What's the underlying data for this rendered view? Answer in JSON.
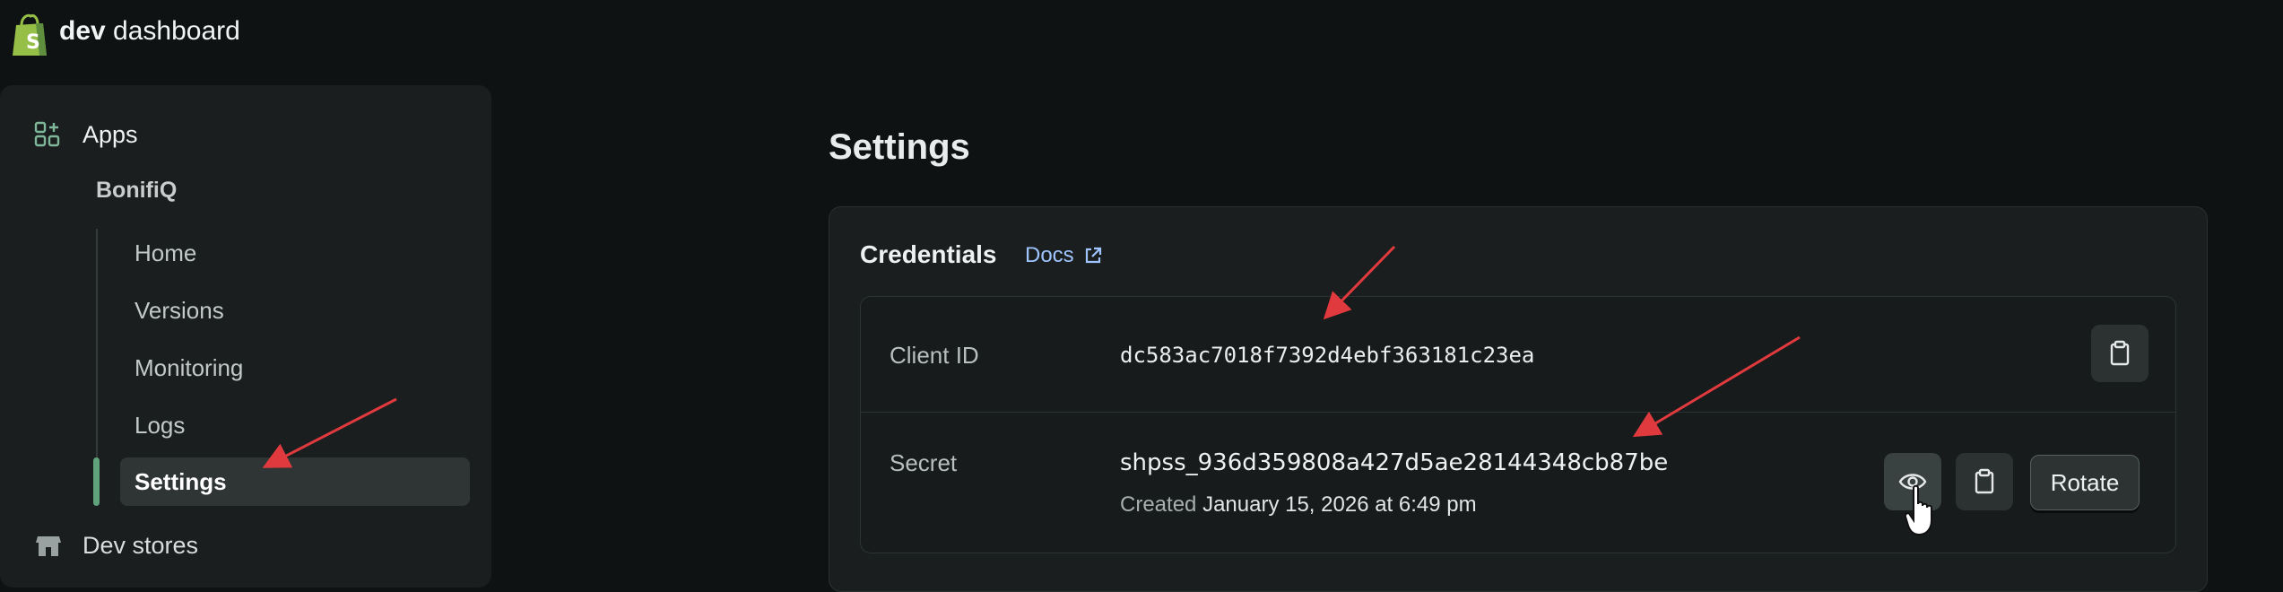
{
  "header": {
    "brand_bold": "dev",
    "brand_rest": "dashboard"
  },
  "sidebar": {
    "apps_label": "Apps",
    "app_name": "BonifiQ",
    "items": [
      {
        "label": "Home"
      },
      {
        "label": "Versions"
      },
      {
        "label": "Monitoring"
      },
      {
        "label": "Logs"
      },
      {
        "label": "Settings",
        "active": true
      }
    ],
    "dev_stores_label": "Dev stores"
  },
  "main": {
    "title": "Settings",
    "credentials": {
      "title": "Credentials",
      "docs_label": "Docs",
      "client_id_label": "Client ID",
      "client_id_value": "dc583ac7018f7392d4ebf363181c23ea",
      "secret_label": "Secret",
      "secret_value": "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",
      "created_prefix": "Created",
      "created_date": "January 15, 2026 at 6:49 pm",
      "rotate_label": "Rotate"
    }
  },
  "colors": {
    "accent_green": "#5fa27c",
    "annotation_red": "#e0393e",
    "link_blue": "#9fc4ff"
  },
  "icons": {
    "logo": "shopify-bag-icon",
    "apps": "apps-grid-plus-icon",
    "dev_stores": "store-icon",
    "docs": "external-link-icon",
    "copy": "clipboard-icon",
    "reveal": "eye-icon",
    "cursor": "hand-pointer-icon"
  }
}
